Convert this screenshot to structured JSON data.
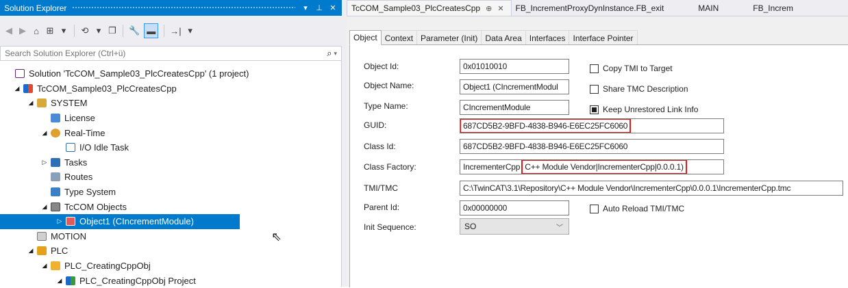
{
  "solution_explorer": {
    "title": "Solution Explorer",
    "title_buttons": {
      "dropdown": "▾",
      "pin": "⊥",
      "close": "✕"
    },
    "toolbar": {
      "back": "◀",
      "forward": "▶",
      "home": "⌂",
      "switch_views": "⊞",
      "switch_views_caret": "▾",
      "history": "⟲",
      "history_caret": "▾",
      "copy": "❐",
      "properties": "🔧",
      "collapse": "▬",
      "preview": "→|",
      "preview_caret": "▾"
    },
    "search": {
      "placeholder": "Search Solution Explorer (Ctrl+ü)",
      "icon": "⌕",
      "caret": "▾"
    },
    "tree": [
      {
        "label": "Solution 'TcCOM_Sample03_PlcCreatesCpp' (1 project)",
        "level": 0,
        "exp": "",
        "icon": "ico-sol",
        "icon_name": "solution-icon"
      },
      {
        "label": "TcCOM_Sample03_PlcCreatesCpp",
        "level": 1,
        "exp": "◢",
        "icon": "ico-proj",
        "icon_name": "project-icon"
      },
      {
        "label": "SYSTEM",
        "level": 2,
        "exp": "◢",
        "icon": "ico-system",
        "icon_name": "system-icon"
      },
      {
        "label": "License",
        "level": 3,
        "exp": "",
        "icon": "ico-license",
        "icon_name": "license-icon"
      },
      {
        "label": "Real-Time",
        "level": 3,
        "exp": "◢",
        "icon": "ico-rt",
        "icon_name": "realtime-icon"
      },
      {
        "label": "I/O Idle Task",
        "level": 4,
        "exp": "",
        "icon": "ico-task",
        "icon_name": "task-icon"
      },
      {
        "label": "Tasks",
        "level": 3,
        "exp": "▷",
        "icon": "ico-tasks",
        "icon_name": "tasks-icon"
      },
      {
        "label": "Routes",
        "level": 3,
        "exp": "",
        "icon": "ico-routes",
        "icon_name": "routes-icon"
      },
      {
        "label": "Type System",
        "level": 3,
        "exp": "",
        "icon": "ico-types",
        "icon_name": "type-system-icon"
      },
      {
        "label": "TcCOM Objects",
        "level": 3,
        "exp": "◢",
        "icon": "ico-tccom",
        "icon_name": "tccom-objects-icon"
      },
      {
        "label": "Object1 (CIncrementModule)",
        "level": 4,
        "exp": "▷",
        "icon": "ico-obj",
        "icon_name": "tccom-object-icon",
        "selected": true
      },
      {
        "label": "MOTION",
        "level": 2,
        "exp": "",
        "icon": "ico-motion",
        "icon_name": "motion-icon"
      },
      {
        "label": "PLC",
        "level": 2,
        "exp": "◢",
        "icon": "ico-plc",
        "icon_name": "plc-icon"
      },
      {
        "label": "PLC_CreatingCppObj",
        "level": 3,
        "exp": "◢",
        "icon": "ico-plcobj",
        "icon_name": "plc-object-icon"
      },
      {
        "label": "PLC_CreatingCppObj Project",
        "level": 4,
        "exp": "◢",
        "icon": "ico-plcproj",
        "icon_name": "plc-project-icon"
      }
    ]
  },
  "doc_tabs": [
    {
      "label": "TcCOM_Sample03_PlcCreatesCpp",
      "pin": "⊕",
      "close": "✕",
      "active": true
    },
    {
      "label": "FB_IncrementProxyDynInstance.FB_exit",
      "active": false
    },
    {
      "label": "MAIN",
      "active": false
    },
    {
      "label": "FB_Increm",
      "active": false
    }
  ],
  "inner_tabs": [
    "Object",
    "Context",
    "Parameter (Init)",
    "Data Area",
    "Interfaces",
    "Interface Pointer"
  ],
  "form": {
    "object_id": {
      "label": "Object Id:",
      "value": "0x01010010"
    },
    "object_name": {
      "label": "Object Name:",
      "value": "Object1 (CIncrementModul"
    },
    "type_name": {
      "label": "Type Name:",
      "value": "CIncrementModule"
    },
    "guid": {
      "label": "GUID:",
      "value": "687CD5B2-9BFD-4838-B946-E6EC25FC6060"
    },
    "class_id": {
      "label": "Class Id:",
      "value": "687CD5B2-9BFD-4838-B946-E6EC25FC6060"
    },
    "class_factory": {
      "label": "Class Factory:",
      "value_a": "IncrementerCpp",
      "value_b": "C++ Module Vendor|IncrementerCpp|0.0.0.1)"
    },
    "tmi_tmc": {
      "label": "TMI/TMC",
      "value": "C:\\TwinCAT\\3.1\\Repository\\C++ Module Vendor\\IncrementerCpp\\0.0.0.1\\IncrementerCpp.tmc"
    },
    "parent_id": {
      "label": "Parent Id:",
      "value": "0x00000000"
    },
    "init_sequence": {
      "label": "Init Sequence:",
      "value": "SO",
      "caret": "﹀"
    },
    "checkboxes": {
      "copy_tmi": {
        "label": "Copy TMI to Target",
        "checked": false
      },
      "share_tmc": {
        "label": "Share TMC Description",
        "checked": false
      },
      "keep_unrestored": {
        "label": "Keep Unrestored Link Info",
        "checked": true
      },
      "auto_reload": {
        "label": "Auto Reload TMI/TMC",
        "checked": false
      }
    }
  }
}
